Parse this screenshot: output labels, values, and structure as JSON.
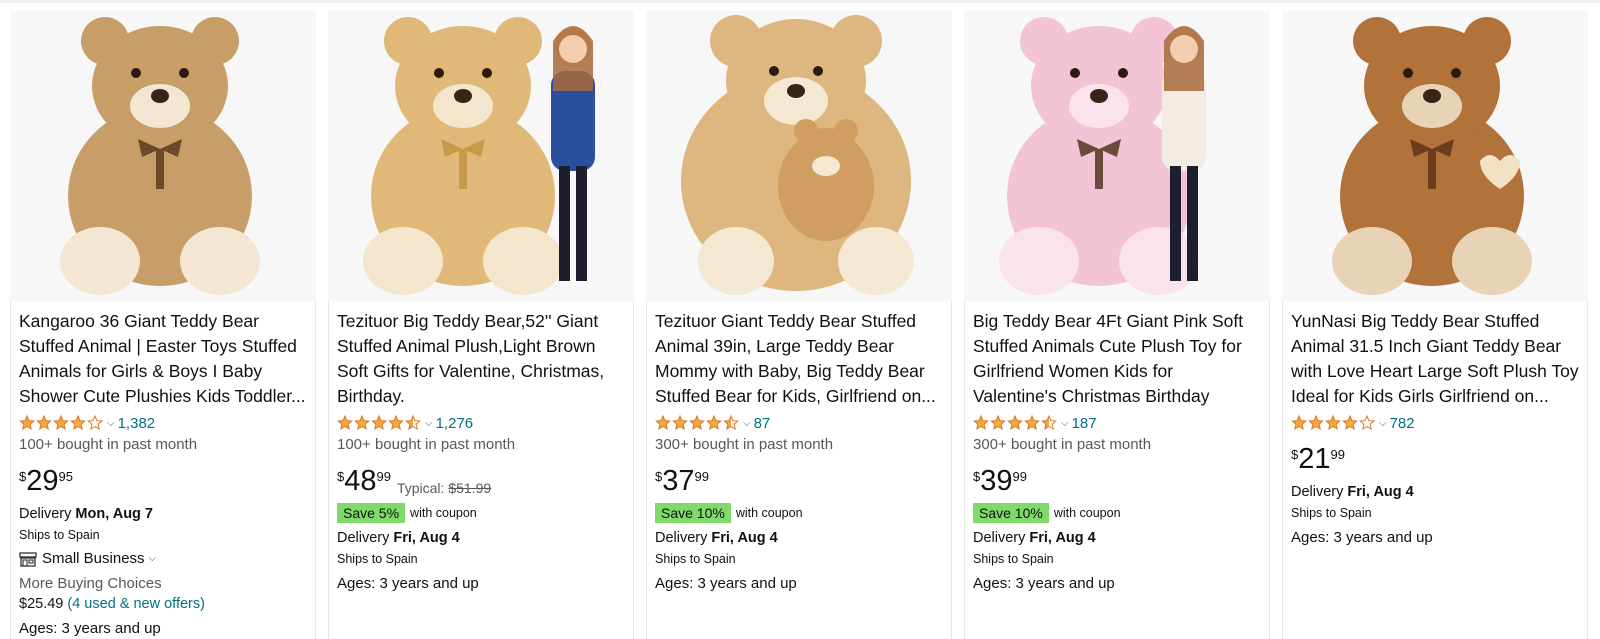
{
  "products": [
    {
      "title": "Kangaroo 36 Giant Teddy Bear Stuffed Animal | Easter Toys Stuffed Animals for Girls & Boys I Baby Shower Cute Plushies Kids Toddler...",
      "stars": 4.0,
      "rating_count": "1,382",
      "bought": "100+ bought in past month",
      "price_symbol": "$",
      "price_whole": "29",
      "price_fraction": "95",
      "typical_label": "",
      "typical_price": "",
      "coupon": "",
      "coupon_text": "",
      "delivery_label": "Delivery ",
      "delivery_date": "Mon, Aug 7",
      "ships": "Ships to Spain",
      "small_business": "Small Business",
      "more_buying": "More Buying Choices",
      "used_price": "$25.49",
      "used_link": "(4 used & new offers)",
      "ages": "Ages: 3 years and up",
      "image": {
        "bear": "#c89e68",
        "muzzle": "#f3e7d4",
        "ribbon": "#6b4a2b",
        "person": false
      }
    },
    {
      "title": "Tezituor Big Teddy Bear,52'' Giant Stuffed Animal Plush,Light Brown Soft Gifts for Valentine, Christmas, Birthday.",
      "stars": 4.5,
      "rating_count": "1,276",
      "bought": "100+ bought in past month",
      "price_symbol": "$",
      "price_whole": "48",
      "price_fraction": "99",
      "typical_label": "Typical: ",
      "typical_price": "$51.99",
      "coupon": "Save 5%",
      "coupon_text": "with coupon",
      "delivery_label": "Delivery ",
      "delivery_date": "Fri, Aug 4",
      "ships": "Ships to Spain",
      "ages": "Ages: 3 years and up",
      "image": {
        "bear": "#e0b878",
        "muzzle": "#f4e6cc",
        "ribbon": "#c79a4a",
        "person": true,
        "shirt": "#2a4f9e"
      }
    },
    {
      "title": "Tezituor Giant Teddy Bear Stuffed Animal 39in, Large Teddy Bear Mommy with Baby, Big Teddy Bear Stuffed Bear for Kids, Girlfriend on...",
      "stars": 4.5,
      "rating_count": "87",
      "bought": "300+ bought in past month",
      "price_symbol": "$",
      "price_whole": "37",
      "price_fraction": "99",
      "coupon": "Save 10%",
      "coupon_text": "with coupon",
      "delivery_label": "Delivery ",
      "delivery_date": "Fri, Aug 4",
      "ships": "Ships to Spain",
      "ages": "Ages: 3 years and up",
      "image": {
        "bear": "#ddb680",
        "muzzle": "#f4e8d2",
        "ribbon": "",
        "person": false
      }
    },
    {
      "title": "Big Teddy Bear 4Ft Giant Pink Soft Stuffed Animals Cute Plush Toy for Girlfriend Women Kids for Valentine's Christmas Birthday",
      "stars": 4.5,
      "rating_count": "187",
      "bought": "300+ bought in past month",
      "price_symbol": "$",
      "price_whole": "39",
      "price_fraction": "99",
      "coupon": "Save 10%",
      "coupon_text": "with coupon",
      "delivery_label": "Delivery ",
      "delivery_date": "Fri, Aug 4",
      "ships": "Ships to Spain",
      "ages": "Ages: 3 years and up",
      "image": {
        "bear": "#f2c4d6",
        "muzzle": "#fae3ec",
        "ribbon": "#6b4a3a",
        "person": true,
        "shirt": "#f3ece0"
      }
    },
    {
      "title": "YunNasi Big Teddy Bear Stuffed Animal 31.5 Inch Giant Teddy Bear with Love Heart Large Soft Plush Toy Ideal for Kids Girls Girlfriend on...",
      "stars": 4.0,
      "rating_count": "782",
      "bought": "",
      "price_symbol": "$",
      "price_whole": "21",
      "price_fraction": "99",
      "coupon": "",
      "coupon_text": "",
      "delivery_label": "Delivery ",
      "delivery_date": "Fri, Aug 4",
      "ships": "Ships to Spain",
      "ages": "Ages: 3 years and up",
      "image": {
        "bear": "#b1733a",
        "muzzle": "#e9d3b6",
        "ribbon": "#6b3d1c",
        "person": false
      }
    }
  ],
  "colors": {
    "star": "#f3a847",
    "link": "#007185",
    "coupon": "#7fda69"
  }
}
